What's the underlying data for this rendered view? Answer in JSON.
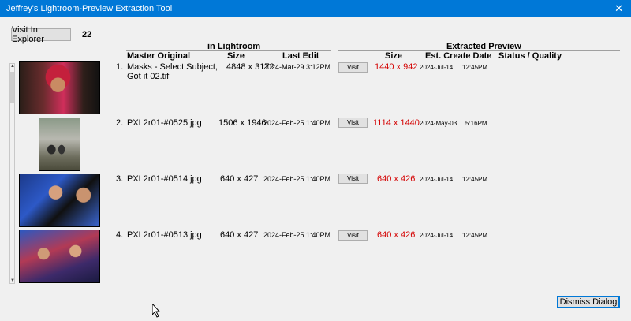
{
  "window": {
    "title": "Jeffrey's Lightroom-Preview Extraction Tool",
    "close_glyph": "✕"
  },
  "toolbar": {
    "visit_explorer_label": "Visit In Explorer",
    "count": "22"
  },
  "headers": {
    "in_lightroom": "in Lightroom",
    "extracted_preview": "Extracted Preview",
    "master_original": "Master Original",
    "size": "Size",
    "last_edit": "Last Edit",
    "extracted_size": "Size",
    "est_create_date": "Est. Create Date",
    "status_quality": "Status / Quality"
  },
  "visit_label": "Visit",
  "rows": [
    {
      "index": "1.",
      "name_line1": "Masks - Select Subject,",
      "name_line2": "Got it 02.tif",
      "size": "4848 x 3172",
      "last_edit": "2024-Mar-29  3:12PM",
      "preview_size": "1440 x 942",
      "create_date": "2024-Jul-14",
      "create_time": "12:45PM",
      "thumbnail": "woman-in-red-hat-photo"
    },
    {
      "index": "2.",
      "name_line1": "PXL2r01-#0525.jpg",
      "name_line2": "",
      "size": "1506 x 1946",
      "last_edit": "2024-Feb-25  1:40PM",
      "preview_size": "1114 x 1440",
      "create_date": "2024-May-03",
      "create_time": "5:16PM",
      "thumbnail": "couple-standing-photo"
    },
    {
      "index": "3.",
      "name_line1": "PXL2r01-#0514.jpg",
      "name_line2": "",
      "size": "640 x 427",
      "last_edit": "2024-Feb-25  1:40PM",
      "preview_size": "640 x 426",
      "create_date": "2024-Jul-14",
      "create_time": "12:45PM",
      "thumbnail": "amusement-ride-photo"
    },
    {
      "index": "4.",
      "name_line1": "PXL2r01-#0513.jpg",
      "name_line2": "",
      "size": "640 x 427",
      "last_edit": "2024-Feb-25  1:40PM",
      "preview_size": "640 x 426",
      "create_date": "2024-Jul-14",
      "create_time": "12:45PM",
      "thumbnail": "amusement-ride-crowd-photo"
    }
  ],
  "footer": {
    "dismiss_label": "Dismiss Dialog"
  },
  "colors": {
    "title_bar": "#0078d7",
    "preview_size": "#d40000",
    "background": "#f0f0f0"
  }
}
